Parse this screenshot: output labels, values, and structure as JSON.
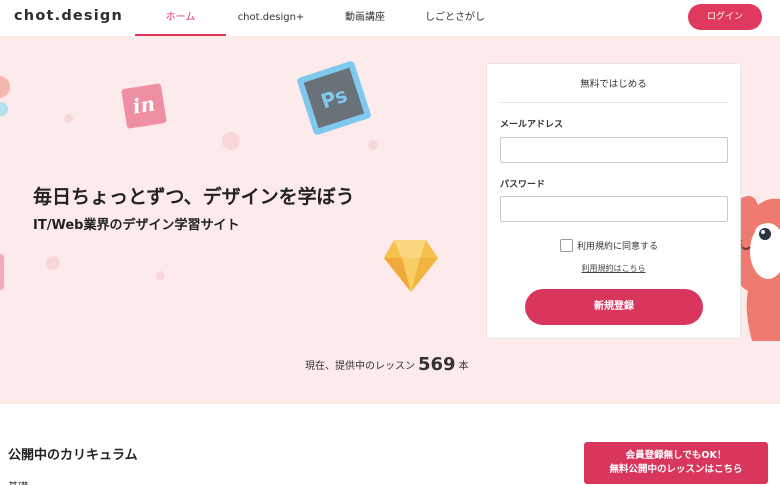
{
  "header": {
    "logo": "chot.design",
    "nav": [
      {
        "label": "ホーム",
        "active": true
      },
      {
        "label": "chot.design+",
        "active": false
      },
      {
        "label": "動画講座",
        "active": false
      },
      {
        "label": "しごとさがし",
        "active": false
      }
    ],
    "login_label": "ログイン"
  },
  "hero": {
    "title": "毎日ちょっとずつ、デザインを学ぼう",
    "subtitle": "IT/Web業界のデザイン学習サイト",
    "lesson_count": {
      "prefix": "現在、提供中のレッスン",
      "number": "569",
      "suffix": "本"
    },
    "icons": [
      "invision-icon",
      "photoshop-icon",
      "gem-icon",
      "mascot-character"
    ],
    "icon_text": {
      "invision": "in",
      "photoshop": "Ps"
    }
  },
  "signup_form": {
    "title": "無料ではじめる",
    "email_label": "メールアドレス",
    "email_value": "",
    "password_label": "パスワード",
    "password_value": "",
    "agree_label": "利用規約に同意する",
    "agree_checked": false,
    "terms_link": "利用規約はこちら",
    "submit_label": "新規登録"
  },
  "curriculum": {
    "title": "公開中のカリキュラム",
    "subtitle": "基礎",
    "free_button_line1": "会員登録無しでもOK！",
    "free_button_line2": "無料公開中のレッスンはこちら"
  },
  "colors": {
    "accent": "#e0395f",
    "hero_bg": "#fdeaea",
    "button": "#d9365d"
  }
}
